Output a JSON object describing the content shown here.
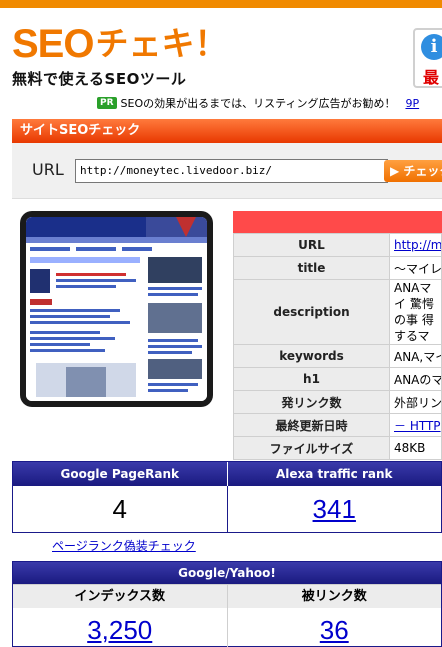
{
  "header": {
    "logo_seo": "SEO",
    "logo_check": "チェキ！",
    "tagline": "無料で使えるSEOツール",
    "info_badge_letter": "i",
    "info_badge_text": "最"
  },
  "promo": {
    "badge": "PR",
    "text": "SEOの効果が出るまでは、リスティング広告がお勧め！",
    "link": "9P"
  },
  "site_check": {
    "section_title": "サイトSEOチェック",
    "url_label": "URL",
    "url_value": "http://moneytec.livedoor.biz/",
    "check_button": "▶ チェック"
  },
  "info_table": {
    "rows": [
      {
        "key": "URL",
        "value": "http://m",
        "link": true
      },
      {
        "key": "title",
        "value": "〜マイレ"
      },
      {
        "key": "description",
        "value": "ANAマイ 驚愕の事 得するマ"
      },
      {
        "key": "keywords",
        "value": "ANA,マイ"
      },
      {
        "key": "h1",
        "value": "ANAのマ"
      },
      {
        "key": "発リンク数",
        "value": "外部リン"
      },
      {
        "key": "最終更新日時",
        "value": "－ HTTP",
        "link": true
      },
      {
        "key": "ファイルサイズ",
        "value": "48KB"
      }
    ]
  },
  "rank": {
    "pagerank_label": "Google PageRank",
    "pagerank_value": "4",
    "alexa_label": "Alexa traffic rank",
    "alexa_value": "341"
  },
  "fake_pr_link": "ページランク偽装チェック",
  "google_yahoo": {
    "title": "Google/Yahoo!",
    "index_label": "インデックス数",
    "index_value": "3,250",
    "backlink_label": "被リンク数",
    "backlink_value": "36"
  },
  "colors": {
    "accent_orange": "#f07800",
    "section_red": "#e83800",
    "table_head_red": "#ff4a4a",
    "navy": "#1a1a80",
    "link_blue": "#0000cc"
  }
}
